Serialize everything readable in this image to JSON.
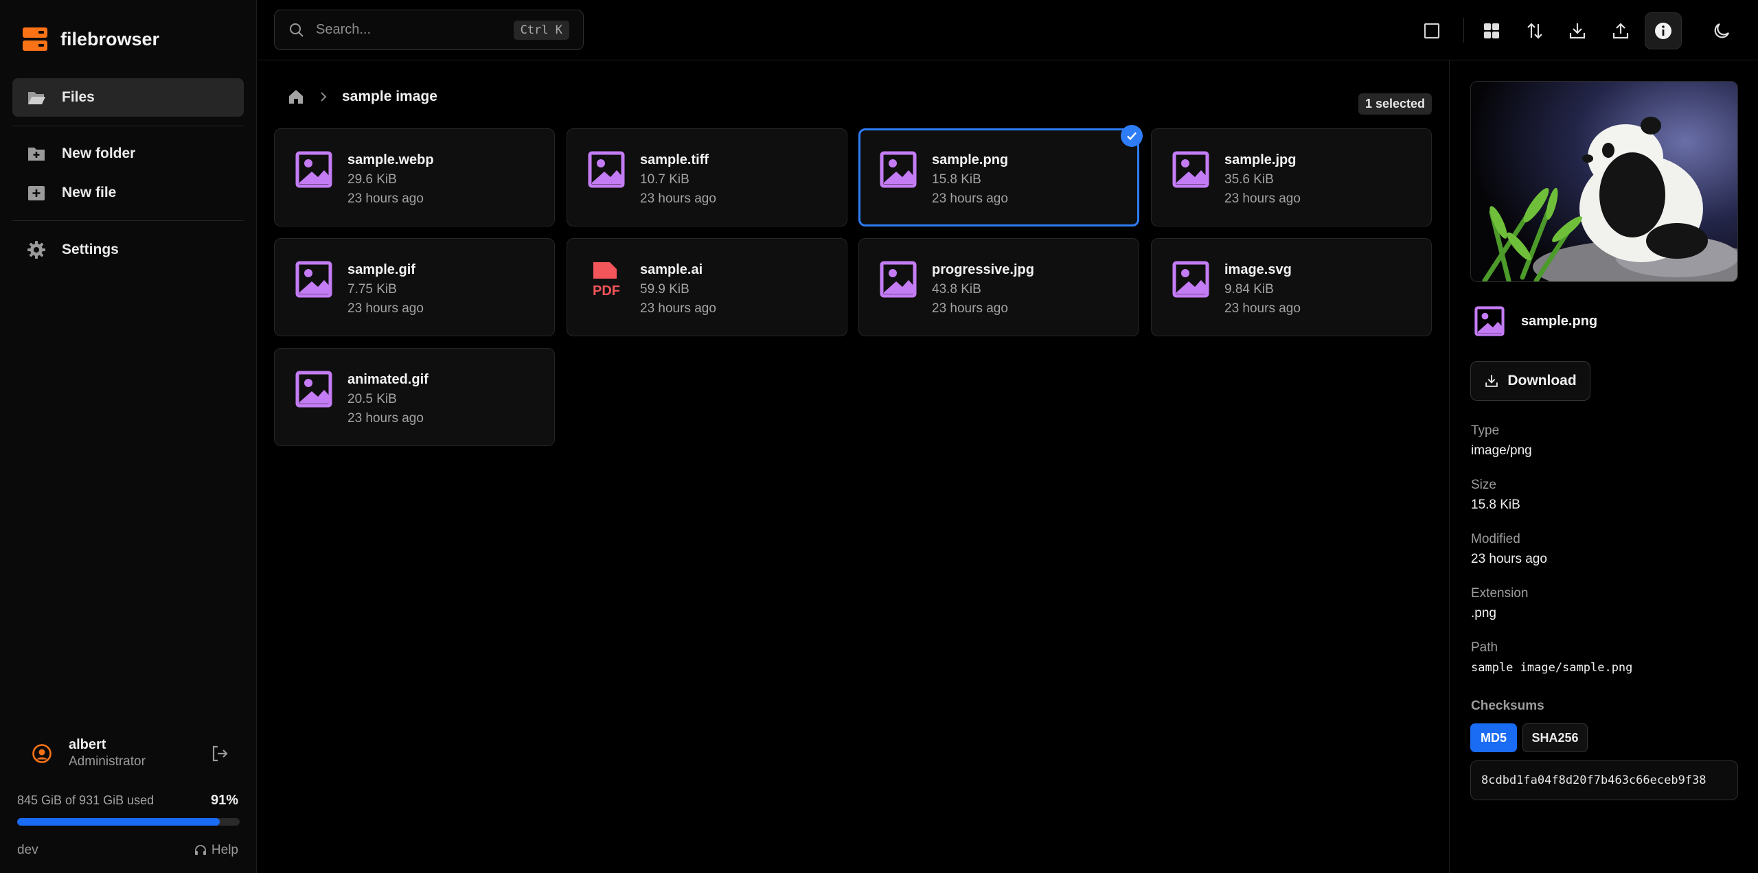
{
  "app": {
    "name": "filebrowser"
  },
  "sidebar": {
    "nav": [
      {
        "label": "Files",
        "icon": "folder-open-icon",
        "active": true
      },
      {
        "label": "New folder",
        "icon": "folder-plus-icon"
      },
      {
        "label": "New file",
        "icon": "file-plus-icon"
      },
      {
        "label": "Settings",
        "icon": "gear-icon"
      }
    ],
    "user": {
      "name": "albert",
      "role": "Administrator"
    },
    "storage": {
      "text": "845 GiB of 931 GiB used",
      "percent_label": "91%",
      "fraction": 0.91
    },
    "version": "dev",
    "help_label": "Help"
  },
  "search": {
    "placeholder": "Search...",
    "shortcut": "Ctrl K"
  },
  "breadcrumb": {
    "current": "sample image"
  },
  "selection_badge": "1 selected",
  "files": [
    {
      "name": "sample.webp",
      "size": "29.6 KiB",
      "modified": "23 hours ago",
      "kind": "image"
    },
    {
      "name": "sample.tiff",
      "size": "10.7 KiB",
      "modified": "23 hours ago",
      "kind": "image"
    },
    {
      "name": "sample.png",
      "size": "15.8 KiB",
      "modified": "23 hours ago",
      "kind": "image",
      "selected": true
    },
    {
      "name": "sample.jpg",
      "size": "35.6 KiB",
      "modified": "23 hours ago",
      "kind": "image"
    },
    {
      "name": "sample.gif",
      "size": "7.75 KiB",
      "modified": "23 hours ago",
      "kind": "image"
    },
    {
      "name": "sample.ai",
      "size": "59.9 KiB",
      "modified": "23 hours ago",
      "kind": "pdf",
      "badge": "PDF"
    },
    {
      "name": "progressive.jpg",
      "size": "43.8 KiB",
      "modified": "23 hours ago",
      "kind": "image"
    },
    {
      "name": "image.svg",
      "size": "9.84 KiB",
      "modified": "23 hours ago",
      "kind": "image"
    },
    {
      "name": "animated.gif",
      "size": "20.5 KiB",
      "modified": "23 hours ago",
      "kind": "image"
    }
  ],
  "details": {
    "name": "sample.png",
    "download_label": "Download",
    "type_label": "Type",
    "type": "image/png",
    "size_label": "Size",
    "size": "15.8 KiB",
    "modified_label": "Modified",
    "modified": "23 hours ago",
    "extension_label": "Extension",
    "extension": ".png",
    "path_label": "Path",
    "path": "sample image/sample.png",
    "checksums_label": "Checksums",
    "checksum_tabs": [
      "MD5",
      "SHA256"
    ],
    "active_checksum": "MD5",
    "hash": "8cdbd1fa04f8d20f7b463c66eceb9f38"
  },
  "colors": {
    "accent": "#1a6cf5",
    "brand": "#f97316",
    "image_icon": "#c47cf5",
    "pdf_icon": "#f2555a"
  }
}
